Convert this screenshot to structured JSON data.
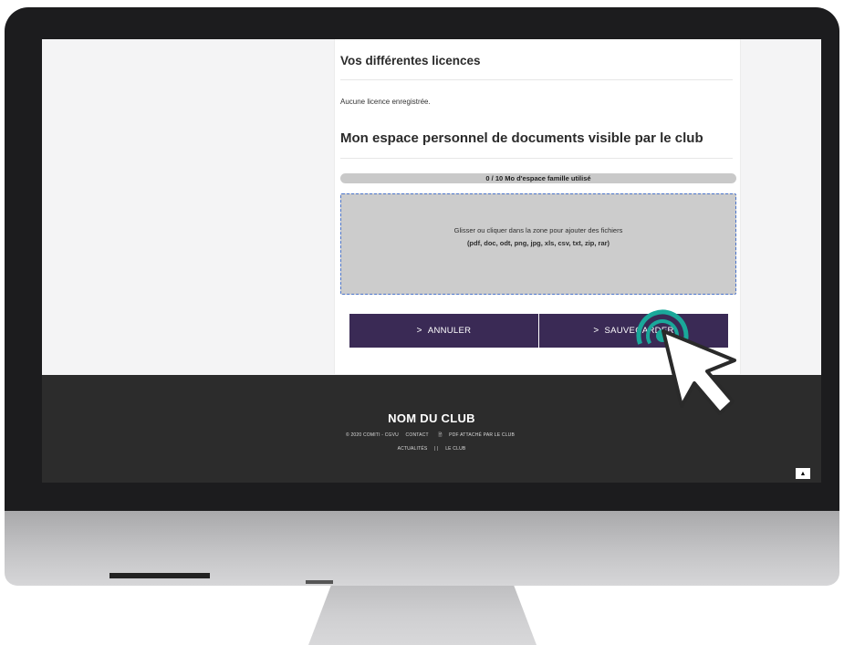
{
  "licences": {
    "title": "Vos différentes licences",
    "empty_text": "Aucune licence enregistrée."
  },
  "documents": {
    "title": "Mon espace personnel de documents visible par le club",
    "quota_text": "0 / 10 Mo d'espace famille utilisé",
    "quota_used_fraction": 0,
    "dropzone_line1": "Glisser ou cliquer dans la zone pour ajouter des fichiers",
    "dropzone_line2": "(pdf, doc, odt, png, jpg, xls, csv, txt, zip, rar)"
  },
  "actions": {
    "cancel_label": "ANNULER",
    "save_label": "SAUVEGARDER",
    "chevron_icon": "chevron-right-icon"
  },
  "footer": {
    "club_name": "NOM DU CLUB",
    "copyright": "© 2020 COMITI - CGVU",
    "contact": "CONTACT",
    "pdf_link": "PDF ATTACHÉ PAR LE CLUB",
    "nav_news": "ACTUALITÉS",
    "nav_sep": "|  |",
    "nav_club": "LE CLUB",
    "scroll_top_icon": "caret-up-icon"
  },
  "colors": {
    "button_bg": "#3a2a55",
    "footer_bg": "#2c2c2c",
    "highlight_ring": "#1aa89a"
  }
}
